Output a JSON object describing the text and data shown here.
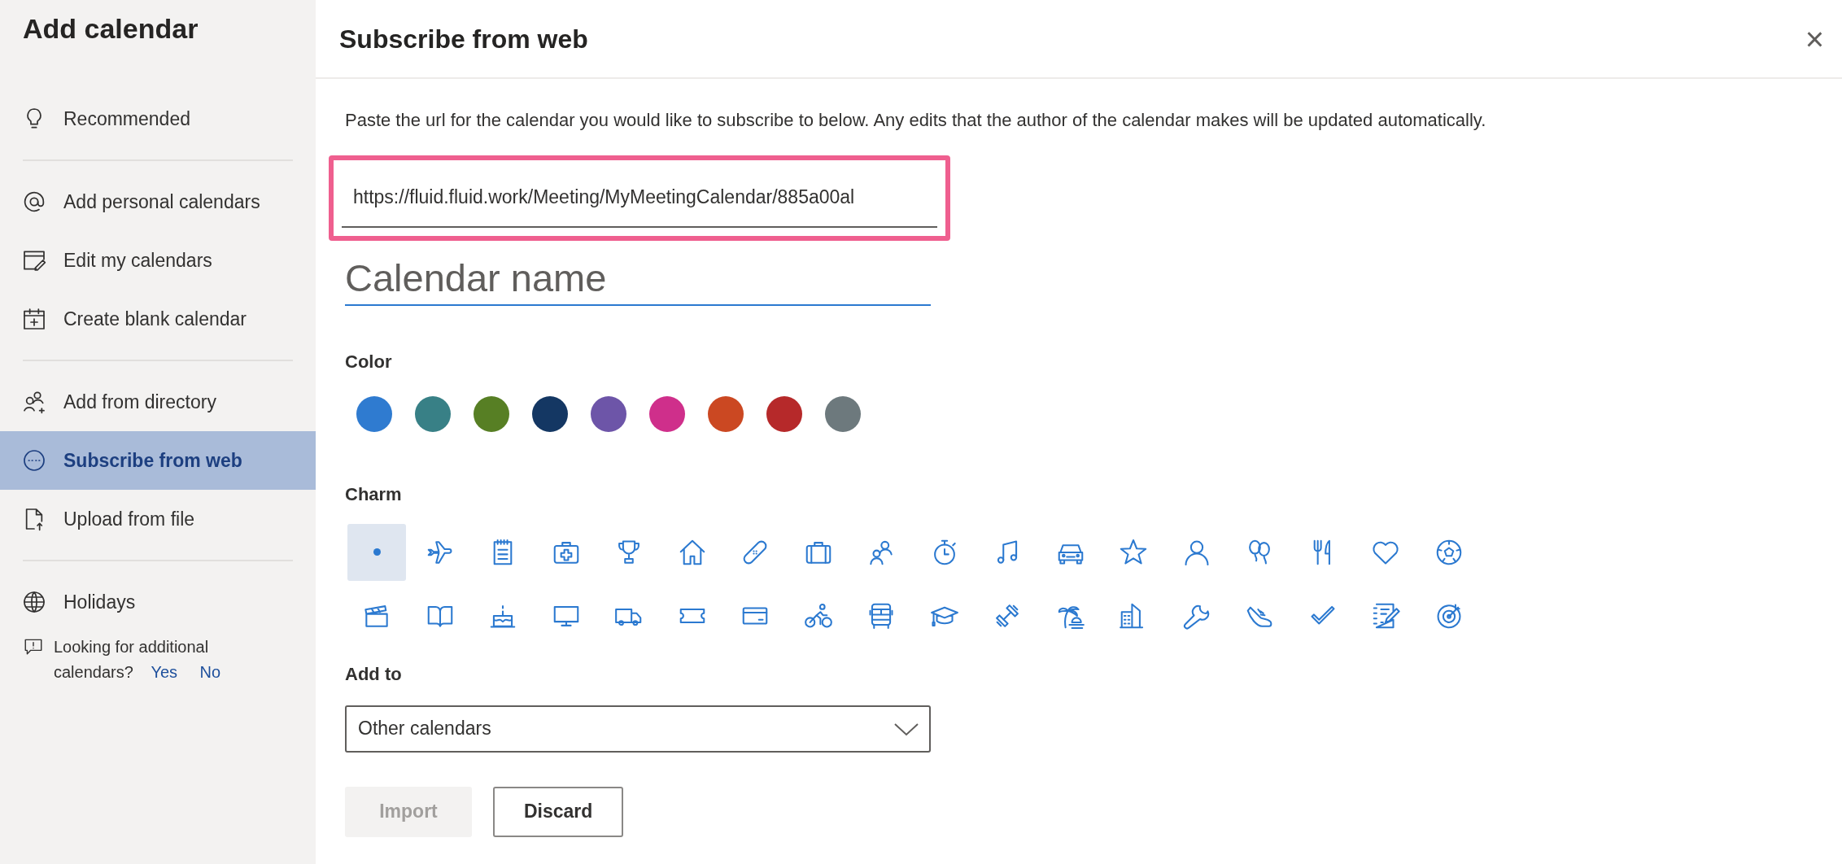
{
  "sidebar": {
    "title": "Add calendar",
    "sections": [
      [
        {
          "label": "Recommended",
          "selected": false
        }
      ],
      [
        {
          "label": "Add personal calendars",
          "selected": false
        },
        {
          "label": "Edit my calendars",
          "selected": false
        },
        {
          "label": "Create blank calendar",
          "selected": false
        }
      ],
      [
        {
          "label": "Add from directory",
          "selected": false
        },
        {
          "label": "Subscribe from web",
          "selected": true
        },
        {
          "label": "Upload from file",
          "selected": false
        }
      ],
      [
        {
          "label": "Holidays",
          "selected": false
        }
      ]
    ],
    "feedback": {
      "question": "Looking for additional calendars?",
      "yes": "Yes",
      "no": "No"
    }
  },
  "panel": {
    "title": "Subscribe from web",
    "close": "×",
    "description": "Paste the url for the calendar you would like to subscribe to below. Any edits that the author of the calendar makes will be updated automatically.",
    "url_field": {
      "value": "https://fluid.fluid.work/Meeting/MyMeetingCalendar/885a00al",
      "highlighted": true
    },
    "name_field": {
      "placeholder": "Calendar name"
    },
    "color_label": "Color",
    "colors": [
      {
        "color": "#2f7bd0",
        "selected": false
      },
      {
        "color": "#388086",
        "selected": false
      },
      {
        "color": "#577f24",
        "selected": false
      },
      {
        "color": "#143763",
        "selected": false
      },
      {
        "color": "#6d55a8",
        "selected": false
      },
      {
        "color": "#cf2f8b",
        "selected": false
      },
      {
        "color": "#cb4822",
        "selected": false
      },
      {
        "color": "#b6292a",
        "selected": false
      },
      {
        "color": "#6d797d",
        "selected": false
      }
    ],
    "charm_label": "Charm",
    "charms": [
      {
        "selected": true
      },
      {
        "selected": false
      },
      {
        "selected": false
      },
      {
        "selected": false
      },
      {
        "selected": false
      },
      {
        "selected": false
      },
      {
        "selected": false
      },
      {
        "selected": false
      },
      {
        "selected": false
      },
      {
        "selected": false
      },
      {
        "selected": false
      },
      {
        "selected": false
      },
      {
        "selected": false
      },
      {
        "selected": false
      },
      {
        "selected": false
      },
      {
        "selected": false
      },
      {
        "selected": false
      },
      {
        "selected": false
      },
      {
        "selected": false
      },
      {
        "selected": false
      },
      {
        "selected": false
      },
      {
        "selected": false
      },
      {
        "selected": false
      },
      {
        "selected": false
      },
      {
        "selected": false
      },
      {
        "selected": false
      },
      {
        "selected": false
      },
      {
        "selected": false
      },
      {
        "selected": false
      },
      {
        "selected": false
      },
      {
        "selected": false
      },
      {
        "selected": false
      },
      {
        "selected": false
      },
      {
        "selected": false
      },
      {
        "selected": false
      },
      {
        "selected": false
      }
    ],
    "add_to_label": "Add to",
    "add_to": {
      "value": "Other calendars"
    },
    "buttons": [
      {
        "label": "Import",
        "disabled": true
      },
      {
        "label": "Discard",
        "disabled": false
      }
    ]
  }
}
